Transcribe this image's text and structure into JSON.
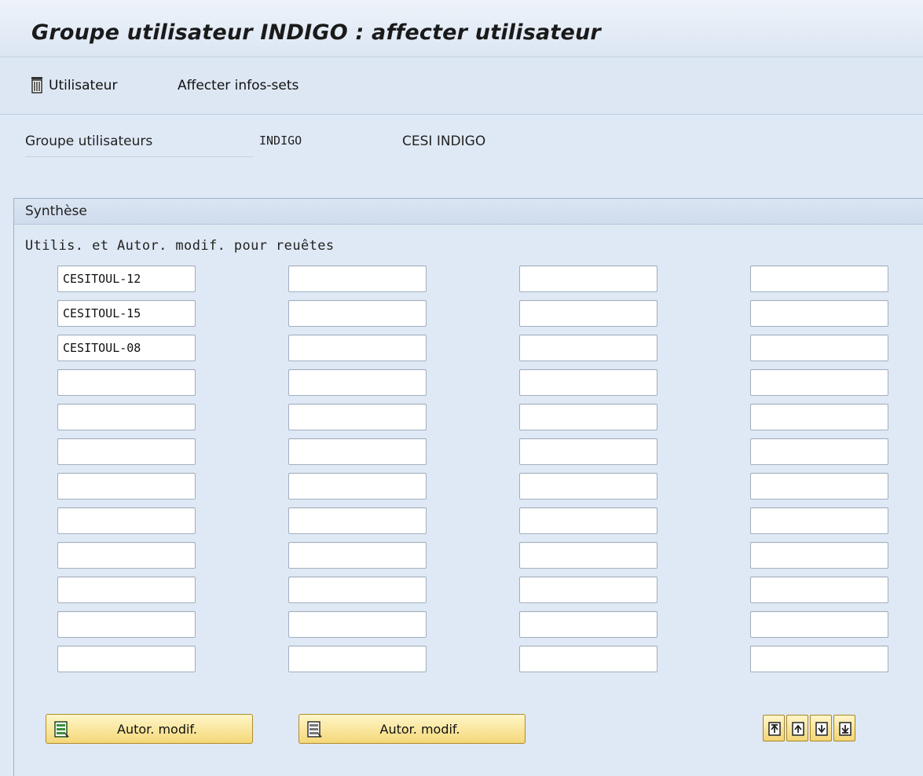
{
  "window": {
    "title": "Groupe utilisateur INDIGO : affecter utilisateur"
  },
  "toolbar": {
    "user_label": "Utilisateur",
    "user_icon": "trash-icon",
    "assign_label": "Affecter infos-sets"
  },
  "header": {
    "group_label": "Groupe utilisateurs",
    "group_code": "INDIGO",
    "group_desc": "CESI INDIGO"
  },
  "panel": {
    "title": "Synthèse",
    "column_label": "Utilis. et Autor. modif. pour reuêtes",
    "rows": [
      [
        "CESITOUL-12",
        "",
        "",
        ""
      ],
      [
        "CESITOUL-15",
        "",
        "",
        ""
      ],
      [
        "CESITOUL-08",
        "",
        "",
        ""
      ],
      [
        "",
        "",
        "",
        ""
      ],
      [
        "",
        "",
        "",
        ""
      ],
      [
        "",
        "",
        "",
        ""
      ],
      [
        "",
        "",
        "",
        ""
      ],
      [
        "",
        "",
        "",
        ""
      ],
      [
        "",
        "",
        "",
        ""
      ],
      [
        "",
        "",
        "",
        ""
      ],
      [
        "",
        "",
        "",
        ""
      ],
      [
        "",
        "",
        "",
        ""
      ]
    ]
  },
  "buttons": {
    "auth1_label": "Autor. modif.",
    "auth2_label": "Autor. modif."
  },
  "nav_icons": [
    "first-page-icon",
    "previous-page-icon",
    "next-page-icon",
    "last-page-icon"
  ],
  "colors": {
    "background": "#dfe9f5",
    "button_yellow": "#f4d878"
  }
}
